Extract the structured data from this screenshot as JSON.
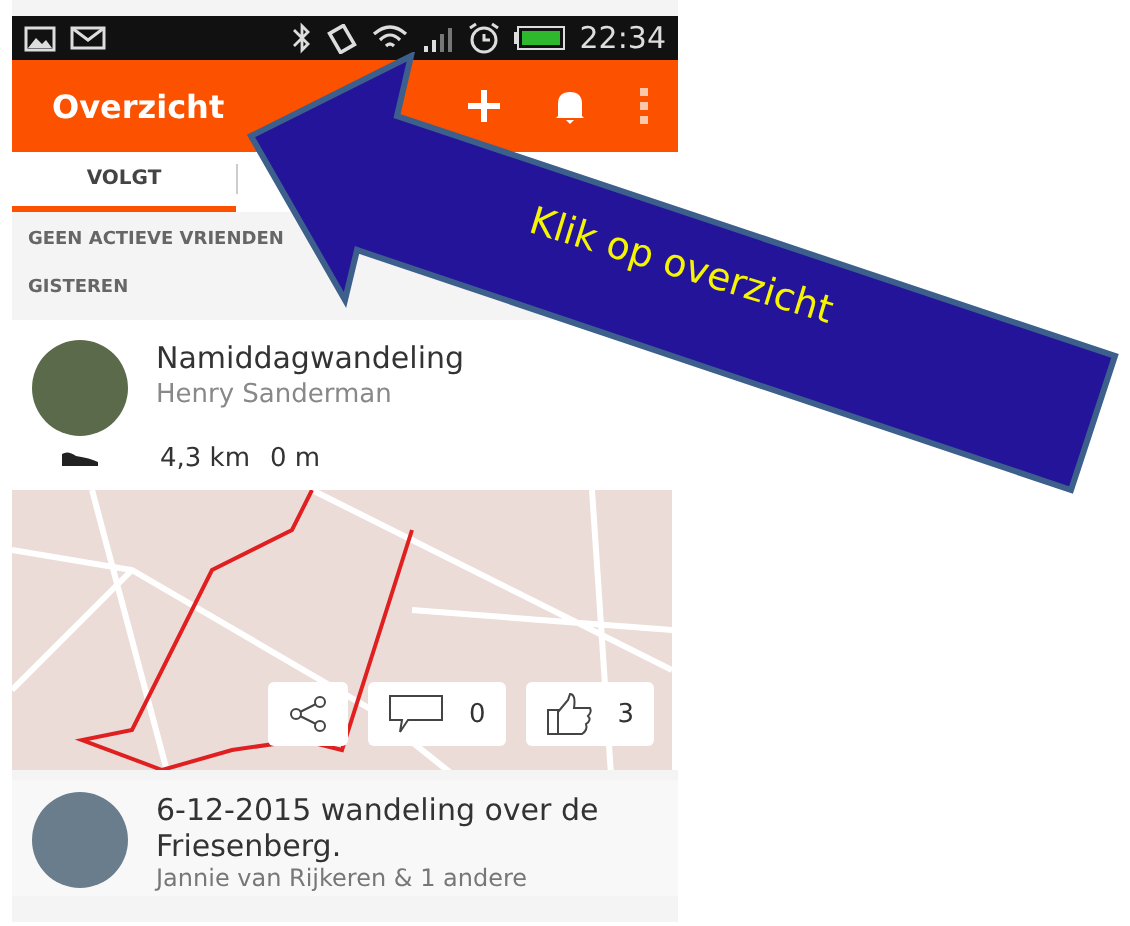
{
  "status_bar": {
    "time": "22:34"
  },
  "app_bar": {
    "title": "Overzicht"
  },
  "tabs": [
    {
      "label": "VOLGT",
      "selected": true
    }
  ],
  "sections": [
    {
      "label": "GEEN ACTIEVE VRIENDEN"
    },
    {
      "label": "GISTEREN"
    }
  ],
  "activities": [
    {
      "title": "Namiddagwandeling",
      "athlete": "Henry Sanderman",
      "distance": "4,3 km",
      "elevation": "0 m",
      "comments": "0",
      "likes": "3"
    },
    {
      "title": "6-12-2015 wandeling over de Friesenberg.",
      "athlete": "Jannie van Rijkeren & 1 andere"
    }
  ],
  "callout": {
    "text": "Klik op overzicht"
  }
}
